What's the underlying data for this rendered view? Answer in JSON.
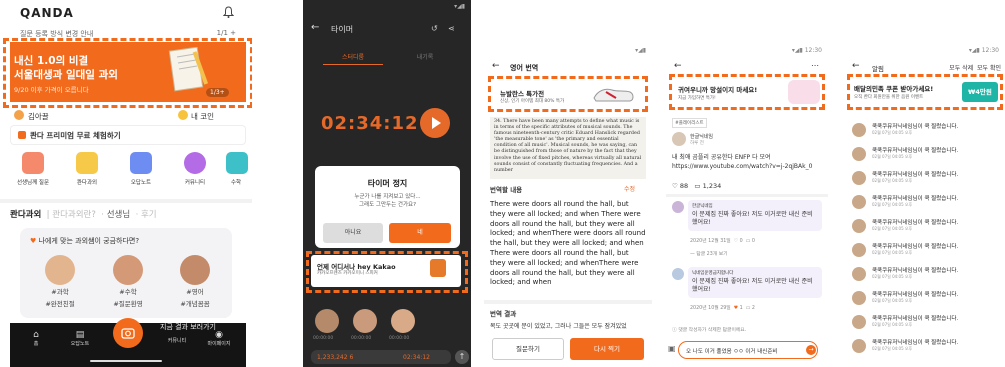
{
  "colors": {
    "accent": "#f26b1d",
    "coupon": "#1fb5a6",
    "dark_bg": "#262626"
  },
  "screen1": {
    "logo": "QANDA",
    "notice": "질문 등록 방식 변경 안내",
    "notice_count": "1/1 +",
    "banner": {
      "title_line1": "내신 1.0의 비결",
      "title_line2": "서울대생과 일대일 과외",
      "subtitle": "9/20 이후 가격이 오릅니다",
      "page": "1/3+"
    },
    "user_name": "김아끌",
    "user_coin": "내 코인",
    "promo": "콴다 프리미엄 무료 체험하기",
    "icons": [
      {
        "label": "선생님께 질문",
        "icon": "hand-icon"
      },
      {
        "label": "콴다과외",
        "icon": "book-icon"
      },
      {
        "label": "오답노트",
        "icon": "notes-icon"
      },
      {
        "label": "커뮤니티",
        "icon": "community-icon"
      },
      {
        "label": "수학",
        "icon": "math-icon"
      }
    ],
    "tabs": {
      "active": "콴다과외",
      "t2": "콴다과외란?",
      "t3": "선생님",
      "t4": "후기"
    },
    "card_question": "나에게 맞는 과외쌤이 궁금하다면?",
    "tutors": [
      {
        "tag1": "#과학",
        "tag2": "#완전친절"
      },
      {
        "tag1": "#수학",
        "tag2": "#질문환영"
      },
      {
        "tag1": "#영어",
        "tag2": "#개념꼼꼼"
      }
    ],
    "bottom_text": "지금 결과 보러가기",
    "nav": {
      "home": "홈",
      "notebook": "오답노트",
      "community": "커뮤니티",
      "mypage": "마이페이지"
    }
  },
  "screen2": {
    "title": "타이머",
    "tab_left": "스터디룸",
    "tab_right": "내기록",
    "timer": "02:34:12",
    "dialog_title": "타이머 정지",
    "dialog_body_1": "누군가 나를 지켜보고 있다...",
    "dialog_body_2": "그래도 그만두는 건가요?",
    "btn_no": "아니요",
    "btn_yes": "네",
    "ad_title": "언제 어디서나 hey Kakao",
    "ad_sub": "카카오프렌즈 카카오미니 스피커",
    "faces": [
      {
        "time": "00:00:00"
      },
      {
        "time": "00:00:00"
      },
      {
        "time": "00:00:00"
      }
    ],
    "stat_left": "1,233,242 6",
    "stat_right": "02:34:12"
  },
  "screen3": {
    "title": "영어 번역",
    "ad_title": "뉴발란스 특가전",
    "ad_sub": "신상, 인기 아이템 최대 80% 특가",
    "scan_text": "34. There have been many attempts to define what music is in terms of the specific attributes of musical sounds. The famous nineteenth-century critic Eduard Hanslick regarded 'the measurable tone' as 'the primary and essential condition of all music'. Musical sounds, he was saying, can be distinguished from those of nature by the fact that they involve the use of fixed pitches, whereas virtually all natural sounds consist of constantly fluctuating frequencies. And a number",
    "orig_label": "번역할 내용",
    "edit": "수정",
    "orig_text": "There were doors all round the hall, but they were all locked; and when There were doors all round the hall, but they were all locked; and whenThere were doors all round the hall, but they were all locked; and when There were doors all round the hall, but they were all locked; and whenThere were doors all round the hall, but they were all locked; and when",
    "result_label": "번역 결과",
    "result_text": "복도 곳곳에 문이 있었고, 그러나 그들은 모두 잠겨있었",
    "btn_ask": "질문하기",
    "btn_redo": "다시 찍기"
  },
  "screen4": {
    "time": "12:30",
    "ad_title": "귀여우니까 망설이지 마세요!",
    "ad_sub": "지금 가입하면 특가!",
    "tag": "#플레이리스트",
    "post_name": "한글닉네임",
    "post_time": "하루 전",
    "post_body": "내 최애 곰플리 공유한다 ENFP 다 모여 https://www.youtube.com/watch?v=j-2qjBAk_0",
    "likes": "88",
    "comments": "1,234",
    "comment1": {
      "name": "한글닉네임",
      "text": "이 문제집 진짜 좋아요! 저도 이거로만 내신 준비 했어요!",
      "date": "2020년 12월 31일",
      "likes": "0",
      "replies": "0"
    },
    "more_replies": "답글 23개 보기",
    "comment2": {
      "name": "닉네임운영금지합니다",
      "text": "이 문제집 진짜 좋아요! 저도 이거로만 내신 준비 했어요!",
      "date": "2020년 10월 29일",
      "likes": "1",
      "replies": "2"
    },
    "notice": "댓글 작성자가 삭제한 답글이에요.",
    "input": "오 나도 이거 풀었음 ㅇㅇ 이거 내신준비"
  },
  "screen5": {
    "time": "12:30",
    "title": "알림",
    "delete_all": "모두 삭제",
    "read_all": "모두 확인",
    "ad_title": "배달의민족 쿠폰 받아가세요!",
    "ad_sub": "오직 콴다 회원만을 위한 음원 이벤트",
    "coupon": "₩4만원",
    "notifications": [
      {
        "text": "쿡쿡쿠뮤저닉네임님이 쿡 찔렀습니다.",
        "date": "02월 07일 04:05 오후"
      },
      {
        "text": "쿡쿡쿠뮤저닉네임님이 쿡 찔렀습니다.",
        "date": "02월 07일 04:05 오후"
      },
      {
        "text": "쿡쿡쿠뮤저닉네임님이 쿡 찔렀습니다.",
        "date": "02월 07일 04:05 오후"
      },
      {
        "text": "쿡쿡쿠뮤저닉네임님이 쿡 찔렀습니다.",
        "date": "02월 07일 04:05 오후"
      },
      {
        "text": "쿡쿡쿠뮤저닉네임님이 쿡 찔렀습니다.",
        "date": "02월 07일 04:05 오후"
      },
      {
        "text": "쿡쿡쿠뮤저닉네임님이 쿡 찔렀습니다.",
        "date": "02월 07일 04:05 오후"
      },
      {
        "text": "쿡쿡쿠뮤저닉네임님이 쿡 찔렀습니다.",
        "date": "02월 07일 04:05 오후"
      },
      {
        "text": "쿡쿡쿠뮤저닉네임님이 쿡 찔렀습니다.",
        "date": "02월 07일 04:05 오후"
      },
      {
        "text": "쿡쿡쿠뮤저닉네임님이 쿡 찔렀습니다.",
        "date": "02월 07일 04:05 오후"
      },
      {
        "text": "쿡쿡쿠뮤저닉네임님이 쿡 찔렀습니다.",
        "date": "02월 07일 04:05 오후"
      }
    ]
  }
}
